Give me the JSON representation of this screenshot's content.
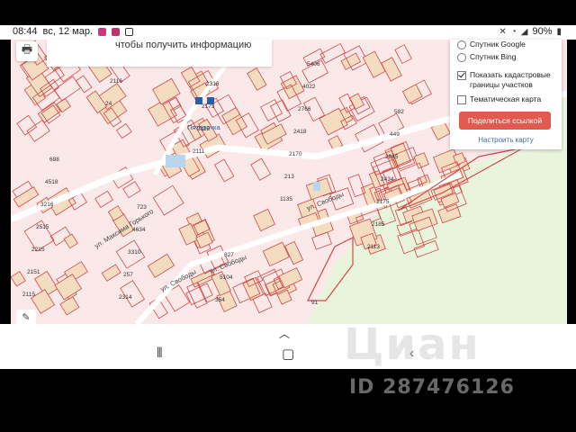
{
  "status_bar": {
    "time": "08:44",
    "date": "вс, 12 мар.",
    "battery": "90%",
    "signal_icon": "signal-icon",
    "wifi_icon": "wifi-icon",
    "battery_icon": "battery-icon"
  },
  "map": {
    "info_text": "чтобы получить информацию",
    "street_labels": [
      "ул. Максима Горького",
      "ул. Свободы",
      "ул. Свободы",
      "ул. Свободы"
    ],
    "place_label": "Пятерочка",
    "parcel_labels": [
      "2435",
      "24",
      "2111",
      "1135",
      "2113",
      "2115",
      "2116",
      "2118",
      "213",
      "2185",
      "2151",
      "2166",
      "2173",
      "2170",
      "2175",
      "2215",
      "2314",
      "2316",
      "2418",
      "2434",
      "2515",
      "257",
      "2640",
      "2766",
      "2845",
      "3216",
      "3310",
      "354",
      "4022",
      "449",
      "4518",
      "4634",
      "5104",
      "5406",
      "582",
      "688",
      "723",
      "827",
      "91"
    ],
    "colors": {
      "background": "#fbe8e8",
      "parcel_stroke": "#d04a4a",
      "parcel_fill": "#f3dcc0",
      "green": "#e9f4dc"
    }
  },
  "layers": {
    "options": [
      {
        "label": "Спутник Google",
        "type": "radio",
        "checked": false
      },
      {
        "label": "Спутник Bing",
        "type": "radio",
        "checked": false
      },
      {
        "label": "Показать кадастровые границы участков",
        "type": "checkbox",
        "checked": true
      },
      {
        "label": "Тематическая карта",
        "type": "checkbox",
        "checked": false
      }
    ],
    "share_label": "Поделиться ссылкой",
    "configure_label": "Настроить карту"
  },
  "toolbar": {
    "print_icon": "printer-icon",
    "edit_icon": "pencil-icon"
  },
  "nav": {
    "recent_icon": "recent-apps-icon",
    "home_icon": "home-icon",
    "back_icon": "back-icon",
    "up_icon": "chevron-up-icon"
  },
  "watermark": {
    "logo": "Циан",
    "id": "ID 287476126"
  }
}
